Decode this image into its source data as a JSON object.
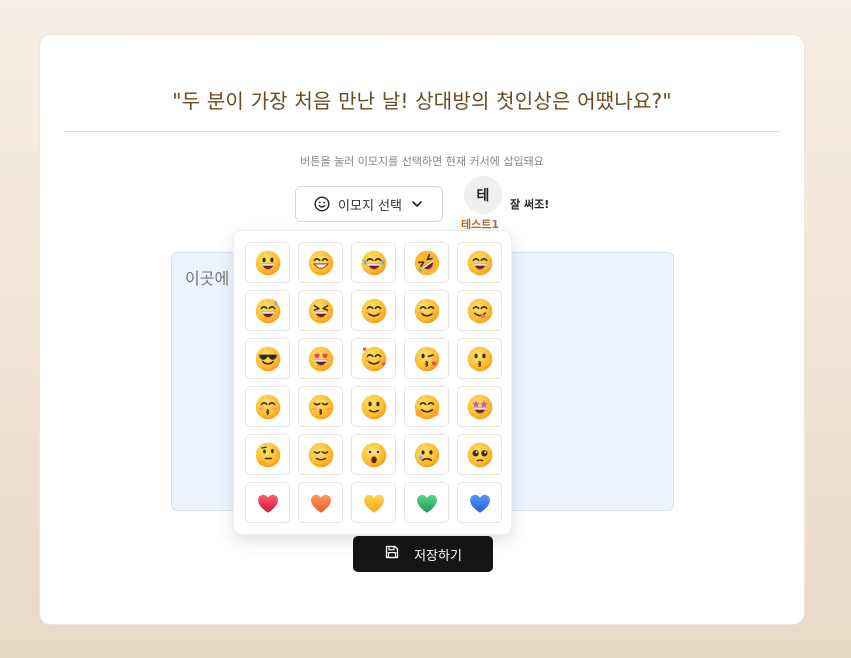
{
  "question": "\"두 분이 가장 처음 만난 날! 상대방의 첫인상은 어땠나요?\"",
  "hint": "버튼을 눌러 이모지를 선택하면 현재 커서에 삽입돼요",
  "emoji_button": {
    "label": "이모지 선택",
    "icon": "smile-icon",
    "chevron": "chevron-down-icon"
  },
  "user": {
    "avatar_initial": "테",
    "name": "테스트1",
    "status": "잘 써조!"
  },
  "textarea": {
    "placeholder": "이곳에"
  },
  "save_button": {
    "label": "저장하기",
    "icon": "save-icon"
  },
  "emoji_picker": {
    "emojis": [
      "grinning-face",
      "beaming-face",
      "tears-of-joy",
      "rolling-laughing",
      "grinning-smiling-eyes",
      "grinning-sweat",
      "squinting-laughing",
      "smiling-halo",
      "smiling-blush",
      "face-savoring",
      "sunglasses-face",
      "heart-eyes",
      "smiling-hearts",
      "kissing-heart",
      "kissing-face",
      "kissing-smiling-eyes",
      "kissing-closed-eyes",
      "slightly-smiling",
      "hugging-face",
      "star-struck",
      "thinking-face",
      "relieved-face",
      "astonished-face",
      "crying-face",
      "pleading-face",
      "red-heart",
      "orange-heart",
      "yellow-heart",
      "green-heart",
      "blue-heart"
    ]
  },
  "colors": {
    "accent": "#b86b33",
    "question": "#6b4a22",
    "textarea_bg": "#eef4fe",
    "save_bg": "#151515"
  }
}
